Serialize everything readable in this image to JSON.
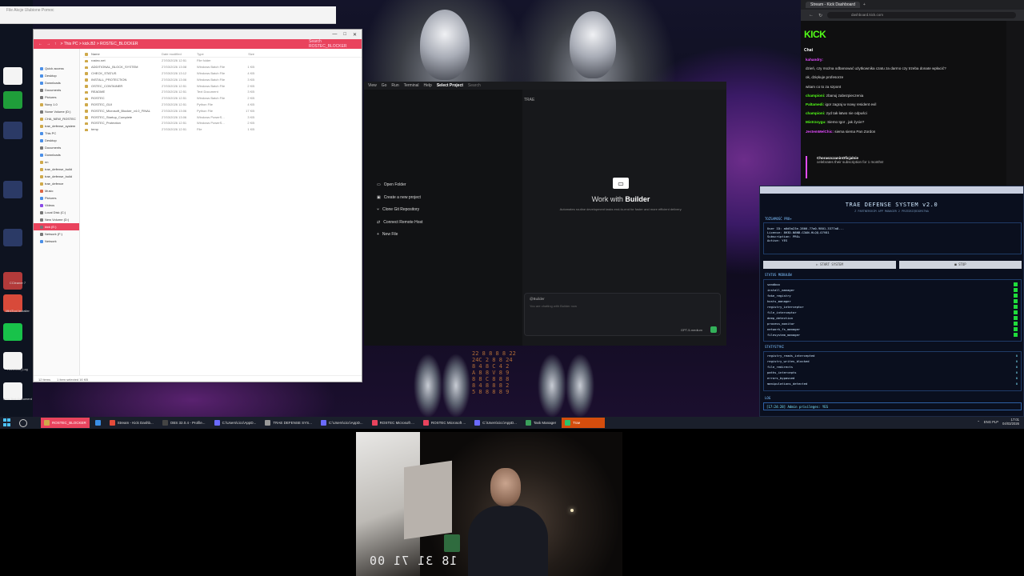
{
  "explorer": {
    "address": "> This PC > kick.B2 > ROSTEC_BLOCKER",
    "search_placeholder": "Search ROSTEC_BLOCKER",
    "columns": [
      "Name",
      "Date modified",
      "Type",
      "Size"
    ],
    "nav_items": [
      {
        "label": "Quick access",
        "color": "#4a8fe7"
      },
      {
        "label": "Desktop",
        "color": "#4a8fe7"
      },
      {
        "label": "Downloads",
        "color": "#4a8fe7"
      },
      {
        "label": "Documents",
        "color": "#777"
      },
      {
        "label": "Pictures",
        "color": "#777"
      },
      {
        "label": "Novy 1.0",
        "color": "#cfa94a"
      },
      {
        "label": "Nowe Volume (D:)",
        "color": "#777"
      },
      {
        "label": "CHA_NEW_ROSTEC",
        "color": "#cfa94a"
      },
      {
        "label": "trae_defense_system",
        "color": "#cfa94a"
      },
      {
        "label": "This PC",
        "color": "#4a8fe7"
      },
      {
        "label": "Desktop",
        "color": "#4a8fe7"
      },
      {
        "label": "Documents",
        "color": "#777"
      },
      {
        "label": "Downloads",
        "color": "#4a8fe7"
      },
      {
        "label": "nn",
        "color": "#cfa94a"
      },
      {
        "label": "trae_defense_build",
        "color": "#cfa94a"
      },
      {
        "label": "trae_defense_build",
        "color": "#cfa94a"
      },
      {
        "label": "trae_defence",
        "color": "#cfa94a"
      },
      {
        "label": "Music",
        "color": "#d64"
      },
      {
        "label": "Pictures",
        "color": "#4a8fe7"
      },
      {
        "label": "Videos",
        "color": "#8a4ae7"
      },
      {
        "label": "Local Disk (C:)",
        "color": "#777"
      },
      {
        "label": "New Volume (D:)",
        "color": "#777"
      },
      {
        "label": "kick (E:)",
        "color": "#777",
        "selected": true
      },
      {
        "label": "Network (F:)",
        "color": "#777"
      },
      {
        "label": "Network",
        "color": "#4a8fe7"
      }
    ],
    "files": [
      {
        "name": "rostec.net",
        "date": "27/03/2026 12:51",
        "type": "File folder",
        "size": ""
      },
      {
        "name": "ADDITIONAL_BLOCK_SYSTEM",
        "date": "27/03/2026 13:08",
        "type": "Windows Batch File",
        "size": "1 KB"
      },
      {
        "name": "CHECK_STATUS",
        "date": "27/03/2026 13:12",
        "type": "Windows Batch File",
        "size": "4 KB"
      },
      {
        "name": "INSTALL_PROTECTION",
        "date": "27/03/2026 13:06",
        "type": "Windows Batch File",
        "size": "3 KB"
      },
      {
        "name": "OSTEC_CONTAINER",
        "date": "27/03/2026 12:51",
        "type": "Windows Batch File",
        "size": "2 KB"
      },
      {
        "name": "README",
        "date": "27/03/2026 12:51",
        "type": "Text Document",
        "size": "3 KB"
      },
      {
        "name": "ROSTEC",
        "date": "27/03/2026 12:51",
        "type": "Windows Batch File",
        "size": "2 KB"
      },
      {
        "name": "ROSTEC_GUI",
        "date": "27/03/2026 12:51",
        "type": "Python File",
        "size": "4 KB"
      },
      {
        "name": "ROSTEC_Microsoft_Blocker_v4.0_FINAL",
        "date": "27/03/2026 13:06",
        "type": "Python File",
        "size": "17 KB"
      },
      {
        "name": "ROSTEC_Startup_Complete",
        "date": "27/03/2026 13:06",
        "type": "Windows PowerS...",
        "size": "3 KB"
      },
      {
        "name": "ROSTEC_Protection",
        "date": "27/03/2026 12:51",
        "type": "Windows PowerS...",
        "size": "2 KB"
      },
      {
        "name": "temp",
        "date": "27/03/2026 12:51",
        "type": "File",
        "size": "1 KB"
      }
    ],
    "status_items": "12 items",
    "status_selected": "1 item selected  16 KB"
  },
  "topwin": {
    "text": "File   Akcje   Ulubione   Pomoc"
  },
  "trae": {
    "menu": [
      "View",
      "Go",
      "Run",
      "Terminal",
      "Help"
    ],
    "project": "Select Project",
    "search": "Search",
    "tab_label": "TRAE",
    "actions": [
      {
        "label": "Open Folder",
        "icon": "folder-icon",
        "glyph": "▭"
      },
      {
        "label": "Create a new project",
        "icon": "create-project-icon",
        "glyph": "▣"
      },
      {
        "label": "Clone Git Repository",
        "icon": "git-icon",
        "glyph": "⑂"
      },
      {
        "label": "Connect Remote Host",
        "icon": "remote-icon",
        "glyph": "⇄"
      },
      {
        "label": "New File",
        "icon": "plus-icon",
        "glyph": "+"
      }
    ],
    "builder_prefix": "Work with",
    "builder_name": "Builder",
    "builder_sub": "Automates routine development tasks end-to-end for faster and more efficient delivery.",
    "chat_who": "@Builder",
    "chat_placeholder": "You are chatting with Builder now",
    "model": "GPT-5-medium"
  },
  "browser": {
    "tab": "Stream - Kick Dashboard",
    "url": "dashboard.kick.com",
    "logo": "KICK",
    "chat_title": "Chat",
    "chat": [
      {
        "user": "kahandry:",
        "cls": "p",
        "msg": ""
      },
      {
        "user": "",
        "cls": "b",
        "msg": "dzień, czy można odbanować użytkownika czatu za darmo czy trzeba donate wpłacić?"
      },
      {
        "user": "",
        "cls": "o",
        "msg": "ok, dziękuje profesorze"
      },
      {
        "user": "",
        "cls": "b",
        "msg": "witam co to za szpont"
      },
      {
        "user": "championi:",
        "cls": "",
        "msg": "zbanuj zabezpieczenia"
      },
      {
        "user": "Paltamedi:",
        "cls": "",
        "msg": "igor zagraj w nowy resident evil"
      },
      {
        "user": "championi:",
        "cls": "",
        "msg": "zyd tak łatwo nie odpuści"
      },
      {
        "user": "Mistrzoygu:",
        "cls": "",
        "msg": "Siemo Igor , jak życie?"
      },
      {
        "user": "JestemMelChic:",
        "cls": "p",
        "msg": "siema siema   Pan Zordon"
      }
    ],
    "pinned_user": "ChoraszczaninOficjalnie",
    "pinned_msg": "celebrates their subscription for 1 months!"
  },
  "defense": {
    "title": "TRAE DEFENSE SYSTEM v2.0",
    "subtitle": "Z PARTNERSKIM APP MANAGER 2 PRZEDSIĘBIORSTWA",
    "identity_title": "TOŻSAMOŚĆ PRO+",
    "identity": [
      "User ID: a0d5a23e-2866-77a0-9801-3377a8...",
      "License: 8H3D-N8NB-G3AN-HLQQ-O7V81",
      "Subscription: PRO+",
      "Active: YES"
    ],
    "btn_start": "▷ START SYSTEM",
    "btn_stop": "■ STOP",
    "modules_title": "STATUS MODUŁÓW",
    "modules": [
      "sandbox",
      "install_manager",
      "fake_registry",
      "hosts_manager",
      "registry_interceptor",
      "file_interceptor",
      "deep_detection",
      "process_monitor",
      "network_fs_manager",
      "filesystem_manager"
    ],
    "stats_title": "STATYSTYKI",
    "stats": [
      {
        "k": "registry_reads_intercepted",
        "v": "0"
      },
      {
        "k": "registry_writes_blocked",
        "v": "0"
      },
      {
        "k": "file_redirects",
        "v": "0"
      },
      {
        "k": "paths_intercepts",
        "v": "0"
      },
      {
        "k": "errors_bypassed",
        "v": "0"
      },
      {
        "k": "manipulations_detected",
        "v": "0"
      }
    ],
    "log_title": "LOG",
    "log": "[17:24:28] Admin privileges: YES"
  },
  "taskbar": {
    "items": [
      {
        "label": "ROSTEC_BLOCKER",
        "color": "#cfa94a",
        "active": true
      },
      {
        "label": "",
        "color": "#3a8ee6"
      },
      {
        "label": "Stream - Kick Dashb...",
        "color": "#e34b3a"
      },
      {
        "label": "OBS 32.0.4 - Profile...",
        "color": "#444"
      },
      {
        "label": "C:\\Users\\cicc\\AppD...",
        "color": "#6b6bff"
      },
      {
        "label": "TRAE DEFENSE SYS...",
        "color": "#999"
      },
      {
        "label": "C:\\Users\\cicc\\AppD...",
        "color": "#6b6bff"
      },
      {
        "label": "ROSTEC Microsoft ...",
        "color": "#e9435d"
      },
      {
        "label": "ROSTEC Microsoft ...",
        "color": "#e9435d"
      },
      {
        "label": "C:\\Users\\cicc\\AppD...",
        "color": "#6b6bff"
      },
      {
        "label": "Task Manager",
        "color": "#3aa05a"
      },
      {
        "label": "Trae",
        "color": "#2cc36b",
        "orange": true
      }
    ],
    "lang": "ENG PLP",
    "time": "17:01",
    "date": "04/03/2026"
  },
  "desktop_icons": [
    "CCleaner 7",
    "MiniTool Installer",
    "ROSTEC_Log",
    "New Text Document"
  ],
  "webcam": {
    "timer": "18 31 71 00"
  }
}
